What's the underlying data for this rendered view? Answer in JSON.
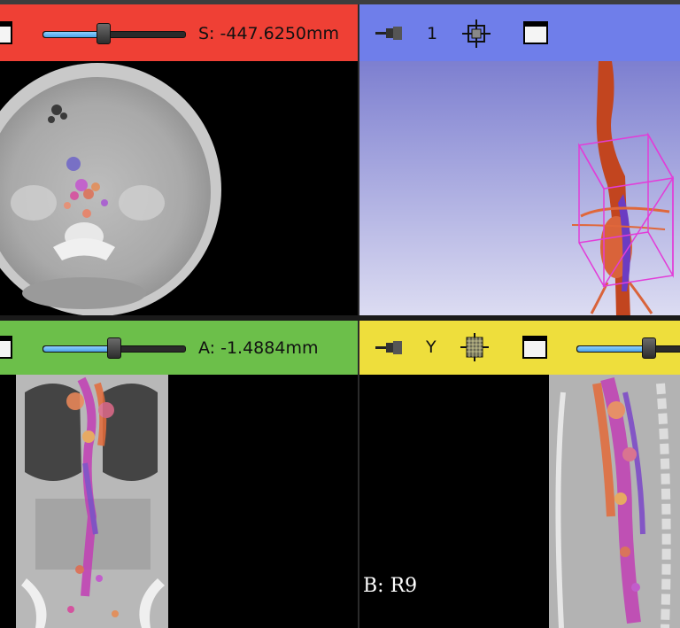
{
  "colors": {
    "red": "#ef4035",
    "blue": "#6f7eea",
    "green": "#6cbf4a",
    "yellow": "#eede3c",
    "slider_fill": "#6bbcf5"
  },
  "panels": {
    "red": {
      "offset_label": "S: -447.6250mm",
      "slider_value_percent": 42,
      "icons": [
        "view-layout-icon",
        "slider-handle"
      ]
    },
    "three_d": {
      "view_index": "1",
      "icons": [
        "pin-icon",
        "center-view-icon",
        "maximize-view-icon"
      ]
    },
    "green": {
      "offset_label": "A: -1.4884mm",
      "slider_value_percent": 47,
      "icons": [
        "view-layout-icon",
        "slider-handle"
      ]
    },
    "yellow": {
      "axis_label": "Y",
      "slider_value_percent": 60,
      "icons": [
        "pin-icon",
        "slice-grid-icon",
        "maximize-view-icon"
      ],
      "overlay_text": "B: R9"
    }
  }
}
